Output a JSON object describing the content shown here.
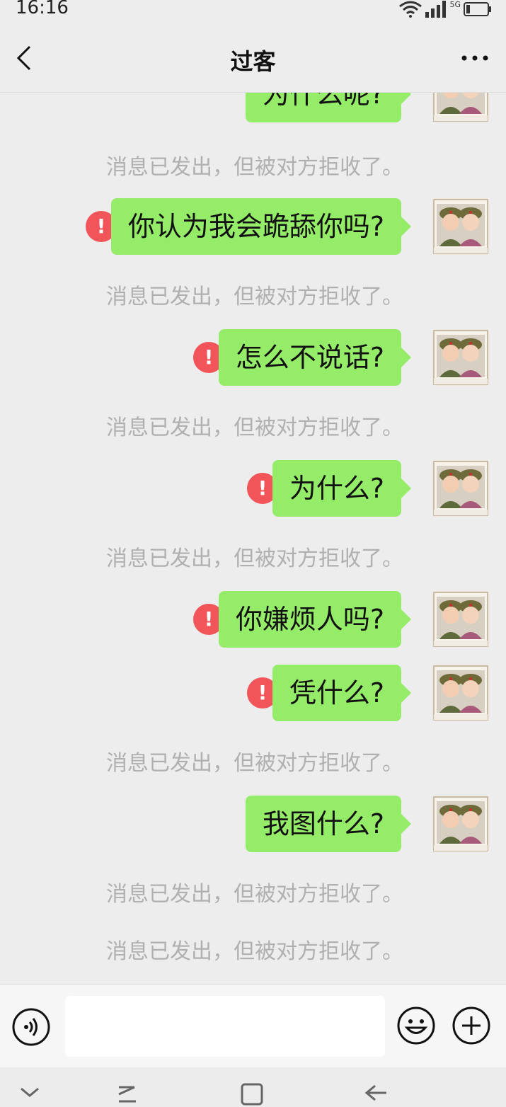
{
  "status_bar": {
    "time": "16:16",
    "network": "5G"
  },
  "header": {
    "title": "过客",
    "back_icon": "chevron-left-icon",
    "more_icon": "more-dots-icon"
  },
  "colors": {
    "bubble": "#95ec69",
    "error": "#f1555a",
    "notice": "#b0b0b0",
    "background": "#ededed"
  },
  "messages": [
    {
      "text": "为什么呢?",
      "status": "failed"
    },
    {
      "text": "你认为我会跪舔你吗?",
      "status": "failed"
    },
    {
      "text": "怎么不说话?",
      "status": "failed"
    },
    {
      "text": "为什么?",
      "status": "failed"
    },
    {
      "text": "你嫌烦人吗?",
      "status": "failed"
    },
    {
      "text": "凭什么?",
      "status": "failed"
    },
    {
      "text": "我图什么?",
      "status": "sending"
    }
  ],
  "notices": [
    "消息已发出，但被对方拒收了。",
    "消息已发出，但被对方拒收了。",
    "消息已发出，但被对方拒收了。",
    "消息已发出，但被对方拒收了。",
    "消息已发出，但被对方拒收了。",
    "消息已发出，但被对方拒收了。",
    "消息已发出，但被对方拒收了。"
  ],
  "error_symbol": "!",
  "input": {
    "value": "",
    "placeholder": ""
  },
  "icons": {
    "voice": "voice-input-icon",
    "emoji": "emoji-icon",
    "plus": "plus-icon",
    "nav": [
      "nav-down-icon",
      "nav-menu-icon",
      "nav-home-icon",
      "nav-back-icon"
    ]
  }
}
